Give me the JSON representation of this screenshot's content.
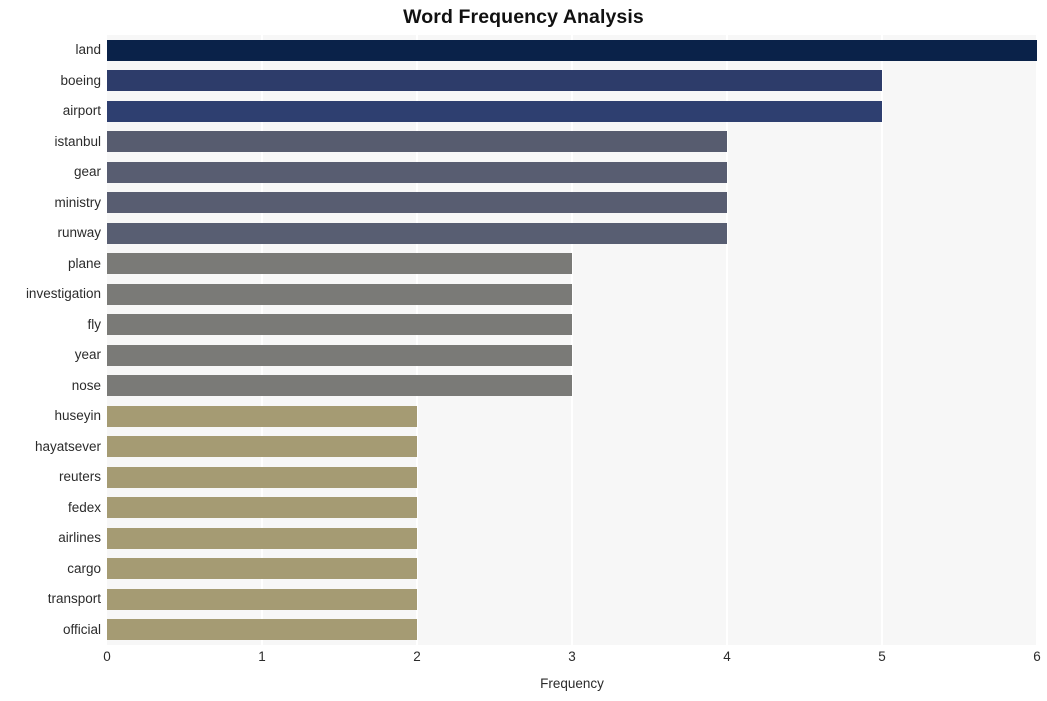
{
  "chart_data": {
    "type": "bar",
    "orientation": "horizontal",
    "title": "Word Frequency Analysis",
    "xlabel": "Frequency",
    "ylabel": "",
    "xlim": [
      0,
      6
    ],
    "xticks": [
      "0",
      "1",
      "2",
      "3",
      "4",
      "5",
      "6"
    ],
    "grid": "vertical-white-on-light",
    "legend": "none",
    "categories": [
      "land",
      "boeing",
      "airport",
      "istanbul",
      "gear",
      "ministry",
      "runway",
      "plane",
      "investigation",
      "fly",
      "year",
      "nose",
      "huseyin",
      "hayatsever",
      "reuters",
      "fedex",
      "airlines",
      "cargo",
      "transport",
      "official"
    ],
    "values": [
      6,
      5,
      5,
      4,
      4,
      4,
      4,
      3,
      3,
      3,
      3,
      3,
      2,
      2,
      2,
      2,
      2,
      2,
      2,
      2
    ],
    "bar_colors": [
      "#0a2249",
      "#2d3c6a",
      "#2e3f70",
      "#575c6f",
      "#585d71",
      "#585d71",
      "#585e72",
      "#7a7a77",
      "#7a7a77",
      "#7a7a77",
      "#7a7a77",
      "#7a7a77",
      "#a59b73",
      "#a59b73",
      "#a59b73",
      "#a59b73",
      "#a59b73",
      "#a59b73",
      "#a59b73",
      "#a59b73"
    ]
  },
  "colors": {
    "plot_background": "#f7f7f7",
    "page_background": "#ffffff",
    "gridline": "#ffffff",
    "text": "#2b2b2b",
    "title_text": "#111111"
  }
}
